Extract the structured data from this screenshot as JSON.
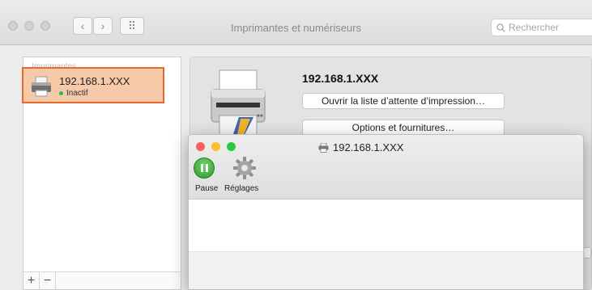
{
  "window": {
    "title": "Imprimantes et numériseurs",
    "back_label": "‹",
    "forward_label": "›",
    "grid_label": "⠿",
    "search_placeholder": "Rechercher"
  },
  "sidebar": {
    "header": "Imprimantes",
    "printer": {
      "name": "192.168.1.XXX",
      "status": "Inactif"
    },
    "add_label": "+",
    "remove_label": "−"
  },
  "details": {
    "printer_name": "192.168.1.XXX",
    "open_queue_label": "Ouvrir la liste d’attente d’impression…",
    "options_label": "Options et fournitures…"
  },
  "queue": {
    "title": "192.168.1.XXX",
    "pause_label": "Pause",
    "settings_label": "Réglages"
  },
  "colors": {
    "selection_fill": "#f6c9a9",
    "selection_border": "#e8692e",
    "status_green": "#37b24d",
    "close_red": "#fe5f57",
    "minimize_yellow": "#febc2e",
    "zoom_green": "#28c840"
  }
}
